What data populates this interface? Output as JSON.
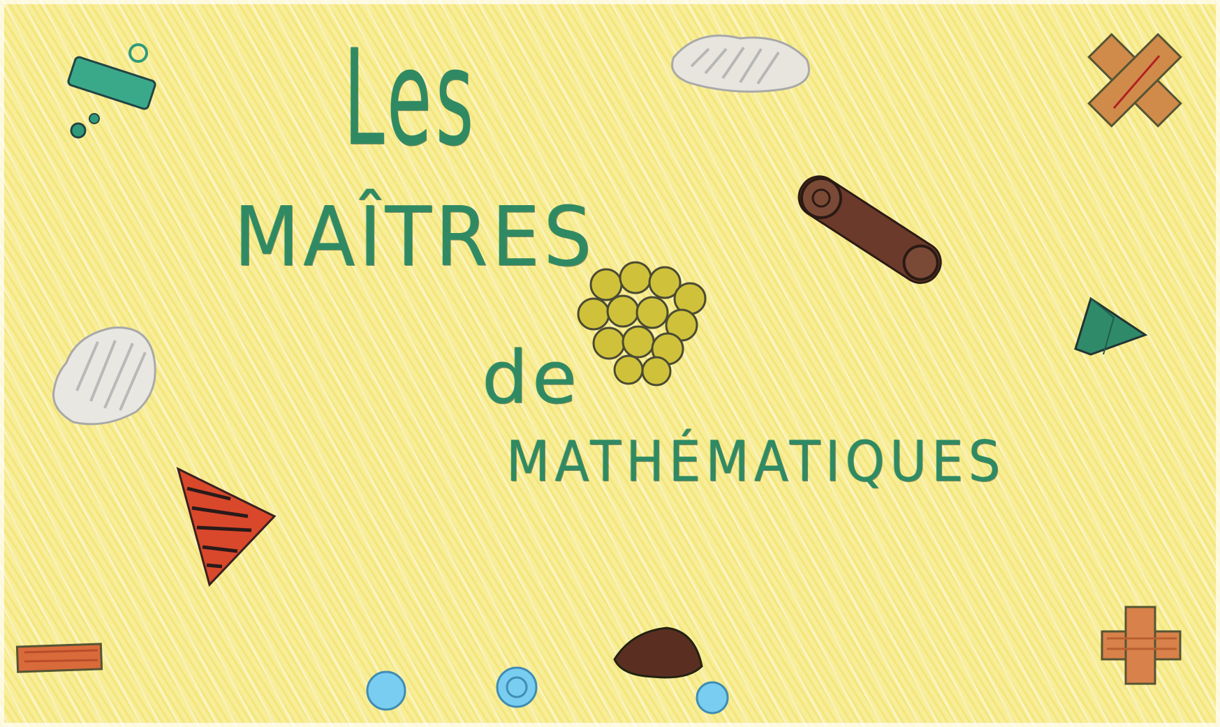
{
  "drawing": {
    "title_line_1": "Les",
    "title_line_2": "MAÎTRES",
    "title_line_3": "de",
    "title_line_4": "MATHÉMATIQUES"
  },
  "colors": {
    "background": "#f8ee9a",
    "title": "#2f8a63",
    "red": "#d9482b",
    "brown": "#6b3a2a",
    "blue": "#6cc4ea",
    "teal": "#2f9a7a",
    "gray": "#bdbdbd"
  }
}
